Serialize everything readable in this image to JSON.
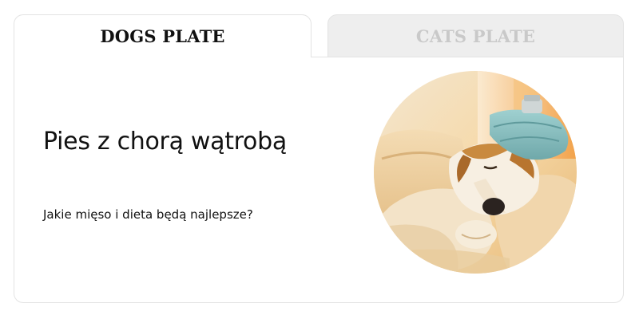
{
  "tabs": {
    "dogs_label": "DOGS PLATE",
    "cats_label": "CATS PLATE"
  },
  "article": {
    "title": "Pies z chorą wątrobą",
    "subtitle": "Jakie mięso i dieta będą najlepsze?"
  },
  "image": {
    "subject": "sick-dog-with-ice-pack",
    "shape": "circle"
  },
  "colors": {
    "active_tab_text": "#111111",
    "inactive_tab_text": "#c9c9c9",
    "inactive_tab_bg": "#eeeeee",
    "border": "#e3e3e3"
  }
}
